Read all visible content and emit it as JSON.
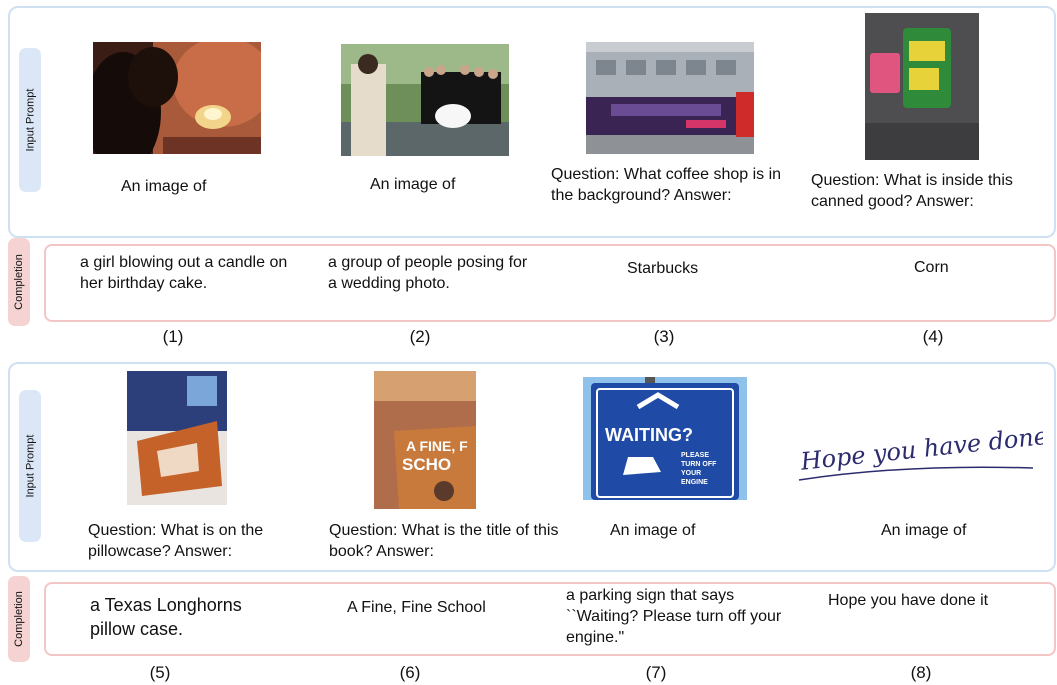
{
  "side_labels": {
    "input": "Input Prompt",
    "completion": "Completion"
  },
  "examples": [
    {
      "number": "(1)",
      "prompt": "An image of",
      "completion": "a girl blowing out a candle on her birthday cake.",
      "image": "birthday-cake-photo"
    },
    {
      "number": "(2)",
      "prompt": "An image of",
      "completion": "a group of people posing for a wedding photo.",
      "image": "wedding-group-photo"
    },
    {
      "number": "(3)",
      "prompt": "Question: What coffee shop is in the background? Answer:",
      "completion": "Starbucks",
      "image": "street-bus-photo"
    },
    {
      "number": "(4)",
      "prompt": "Question: What is inside this canned good? Answer:",
      "completion": "Corn",
      "image": "canned-good-photo"
    },
    {
      "number": "(5)",
      "prompt": "Question: What is on the pillowcase? Answer:",
      "completion": "a Texas Longhorns pillow case.",
      "image": "pillowcase-photo"
    },
    {
      "number": "(6)",
      "prompt": "Question: What is the title of this book? Answer:",
      "completion": "A Fine, Fine School",
      "image": "book-cover-photo"
    },
    {
      "number": "(7)",
      "prompt": "An image of",
      "completion": "a parking sign that says ``Waiting? Please turn off your engine.\"",
      "image": "parking-sign-photo"
    },
    {
      "number": "(8)",
      "prompt": "An image of",
      "completion": "Hope you have done it",
      "image": "handwriting-image"
    }
  ],
  "image_text": {
    "book_title": "A FINE, F\nSCHO",
    "sign_main": "WAITING?",
    "sign_sub": "PLEASE\nTURN OFF\nYOUR\nENGINE",
    "handwriting": "Hope you have done it."
  }
}
